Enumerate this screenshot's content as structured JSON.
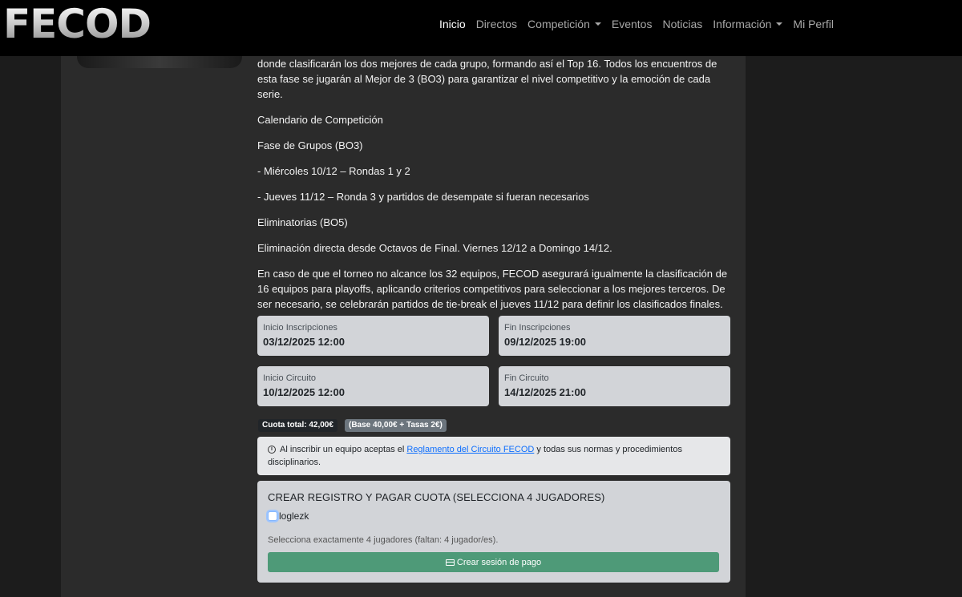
{
  "brand": {
    "logo_text": "FECOD"
  },
  "nav": {
    "items": [
      {
        "label": "Inicio",
        "active": true,
        "dropdown": false
      },
      {
        "label": "Directos",
        "active": false,
        "dropdown": false
      },
      {
        "label": "Competición",
        "active": false,
        "dropdown": true
      },
      {
        "label": "Eventos",
        "active": false,
        "dropdown": false
      },
      {
        "label": "Noticias",
        "active": false,
        "dropdown": false
      },
      {
        "label": "Información",
        "active": false,
        "dropdown": true
      },
      {
        "label": "Mi Perfil",
        "active": false,
        "dropdown": false
      }
    ]
  },
  "content": {
    "intro": "donde clasificarán los dos mejores de cada grupo, formando así el Top 16. Todos los encuentros de esta fase se jugarán al Mejor de 3 (BO3) para garantizar el nivel competitivo y la emoción de cada serie.",
    "calendar_title": "Calendario de Competición",
    "groups_title": "Fase de Grupos (BO3)",
    "groups_day1": "- Miércoles 10/12 – Rondas 1 y 2",
    "groups_day2": "- Jueves 11/12 – Ronda 3 y partidos de desempate si fueran necesarios",
    "knockout_title": "Eliminatorias (BO5)",
    "knockout_text": "Eliminación directa desde Octavos de Final. Viernes 12/12 a Domingo 14/12.",
    "fallback_text": "En caso de que el torneo no alcance los 32 equipos, FECOD asegurará igualmente la clasificación de 16 equipos para playoffs, aplicando criterios competitivos para seleccionar a los mejores terceros. De ser necesario, se celebrarán partidos de tie-break el jueves 11/12 para definir los clasificados finales."
  },
  "dates": {
    "reg_start": {
      "label": "Inicio Inscripciones",
      "value": "03/12/2025 12:00"
    },
    "reg_end": {
      "label": "Fin Inscripciones",
      "value": "09/12/2025 19:00"
    },
    "circuit_start": {
      "label": "Inicio Circuito",
      "value": "10/12/2025 12:00"
    },
    "circuit_end": {
      "label": "Fin Circuito",
      "value": "14/12/2025 21:00"
    }
  },
  "fees": {
    "total": "Cuota total: 42,00€",
    "breakdown": "(Base 40,00€ + Tasas 2€)"
  },
  "notice": {
    "icon": "info-icon",
    "prefix": "Al inscribir un equipo aceptas el ",
    "link": "Reglamento del Circuito FECOD",
    "suffix": " y todas sus normas y procedimientos disciplinarios."
  },
  "registration": {
    "title": "CREAR REGISTRO Y PAGAR CUOTA (SELECCIONA 4 JUGADORES)",
    "players": [
      {
        "name": "loglezk",
        "checked": false
      }
    ],
    "hint": "Selecciona exactamente 4 jugadores (faltan: 4 jugador/es).",
    "pay_button": "Crear sesión de pago",
    "button_color": "#4e9a78"
  }
}
